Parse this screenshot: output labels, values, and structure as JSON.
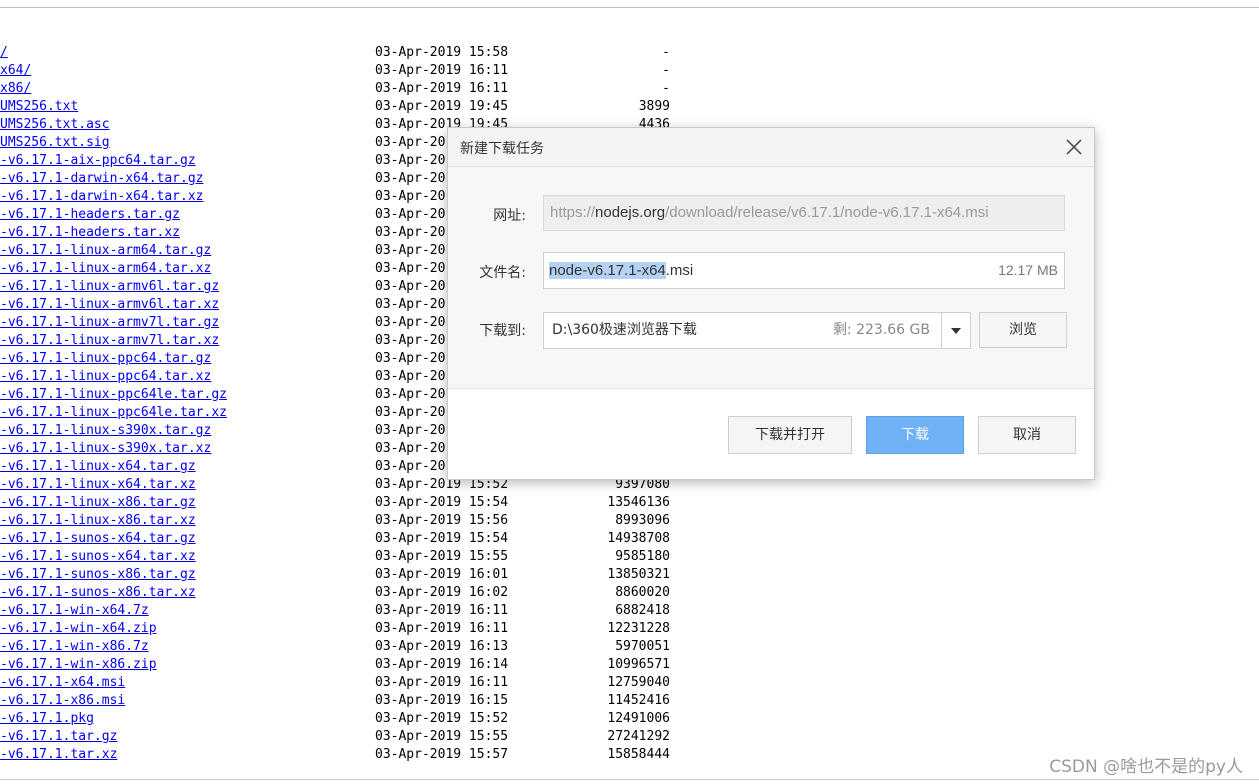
{
  "listing": {
    "rows": [
      {
        "name": "/",
        "date": "03-Apr-2019 15:58",
        "size": "-"
      },
      {
        "name": "x64/",
        "date": "03-Apr-2019 16:11",
        "size": "-"
      },
      {
        "name": "x86/",
        "date": "03-Apr-2019 16:11",
        "size": "-"
      },
      {
        "name": "UMS256.txt",
        "date": "03-Apr-2019 19:45",
        "size": "3899"
      },
      {
        "name": "UMS256.txt.asc",
        "date": "03-Apr-2019 19:45",
        "size": "4436"
      },
      {
        "name": "UMS256.txt.sig",
        "date": "03-Apr-20",
        "size": ""
      },
      {
        "name": "-v6.17.1-aix-ppc64.tar.gz",
        "date": "03-Apr-20",
        "size": ""
      },
      {
        "name": "-v6.17.1-darwin-x64.tar.gz",
        "date": "03-Apr-20",
        "size": ""
      },
      {
        "name": "-v6.17.1-darwin-x64.tar.xz",
        "date": "03-Apr-20",
        "size": ""
      },
      {
        "name": "-v6.17.1-headers.tar.gz",
        "date": "03-Apr-20",
        "size": ""
      },
      {
        "name": "-v6.17.1-headers.tar.xz",
        "date": "03-Apr-20",
        "size": ""
      },
      {
        "name": "-v6.17.1-linux-arm64.tar.gz",
        "date": "03-Apr-20",
        "size": ""
      },
      {
        "name": "-v6.17.1-linux-arm64.tar.xz",
        "date": "03-Apr-20",
        "size": ""
      },
      {
        "name": "-v6.17.1-linux-armv6l.tar.gz",
        "date": "03-Apr-20",
        "size": ""
      },
      {
        "name": "-v6.17.1-linux-armv6l.tar.xz",
        "date": "03-Apr-20",
        "size": ""
      },
      {
        "name": "-v6.17.1-linux-armv7l.tar.gz",
        "date": "03-Apr-20",
        "size": ""
      },
      {
        "name": "-v6.17.1-linux-armv7l.tar.xz",
        "date": "03-Apr-20",
        "size": ""
      },
      {
        "name": "-v6.17.1-linux-ppc64.tar.gz",
        "date": "03-Apr-20",
        "size": ""
      },
      {
        "name": "-v6.17.1-linux-ppc64.tar.xz",
        "date": "03-Apr-20",
        "size": ""
      },
      {
        "name": "-v6.17.1-linux-ppc64le.tar.gz",
        "date": "03-Apr-20",
        "size": ""
      },
      {
        "name": "-v6.17.1-linux-ppc64le.tar.xz",
        "date": "03-Apr-20",
        "size": ""
      },
      {
        "name": "-v6.17.1-linux-s390x.tar.gz",
        "date": "03-Apr-20",
        "size": ""
      },
      {
        "name": "-v6.17.1-linux-s390x.tar.xz",
        "date": "03-Apr-20",
        "size": ""
      },
      {
        "name": "-v6.17.1-linux-x64.tar.gz",
        "date": "03-Apr-20",
        "size": ""
      },
      {
        "name": "-v6.17.1-linux-x64.tar.xz",
        "date": "03-Apr-2019 15:52",
        "size": "9397080"
      },
      {
        "name": "-v6.17.1-linux-x86.tar.gz",
        "date": "03-Apr-2019 15:54",
        "size": "13546136"
      },
      {
        "name": "-v6.17.1-linux-x86.tar.xz",
        "date": "03-Apr-2019 15:56",
        "size": "8993096"
      },
      {
        "name": "-v6.17.1-sunos-x64.tar.gz",
        "date": "03-Apr-2019 15:54",
        "size": "14938708"
      },
      {
        "name": "-v6.17.1-sunos-x64.tar.xz",
        "date": "03-Apr-2019 15:55",
        "size": "9585180"
      },
      {
        "name": "-v6.17.1-sunos-x86.tar.gz",
        "date": "03-Apr-2019 16:01",
        "size": "13850321"
      },
      {
        "name": "-v6.17.1-sunos-x86.tar.xz",
        "date": "03-Apr-2019 16:02",
        "size": "8860020"
      },
      {
        "name": "-v6.17.1-win-x64.7z",
        "date": "03-Apr-2019 16:11",
        "size": "6882418"
      },
      {
        "name": "-v6.17.1-win-x64.zip",
        "date": "03-Apr-2019 16:11",
        "size": "12231228"
      },
      {
        "name": "-v6.17.1-win-x86.7z",
        "date": "03-Apr-2019 16:13",
        "size": "5970051"
      },
      {
        "name": "-v6.17.1-win-x86.zip",
        "date": "03-Apr-2019 16:14",
        "size": "10996571"
      },
      {
        "name": "-v6.17.1-x64.msi",
        "date": "03-Apr-2019 16:11",
        "size": "12759040"
      },
      {
        "name": "-v6.17.1-x86.msi",
        "date": "03-Apr-2019 16:15",
        "size": "11452416"
      },
      {
        "name": "-v6.17.1.pkg",
        "date": "03-Apr-2019 15:52",
        "size": "12491006"
      },
      {
        "name": "-v6.17.1.tar.gz",
        "date": "03-Apr-2019 15:55",
        "size": "27241292"
      },
      {
        "name": "-v6.17.1.tar.xz",
        "date": "03-Apr-2019 15:57",
        "size": "15858444"
      }
    ]
  },
  "watermark": "CSDN @啥也不是的py人",
  "dialog": {
    "title": "新建下载任务",
    "url_label": "网址:",
    "url_prefix": "https://",
    "url_host": "nodejs.org",
    "url_path": "/download/release/v6.17.1/node-v6.17.1-x64.msi",
    "filename_label": "文件名:",
    "filename_selected": "node-v6.17.1-x64",
    "filename_ext": ".msi",
    "file_size": "12.17 MB",
    "saveto_label": "下载到:",
    "save_path": "D:\\360极速浏览器下载",
    "free_space": "剩: 223.66 GB",
    "browse_label": "浏览",
    "download_open_label": "下载并打开",
    "download_label": "下载",
    "cancel_label": "取消"
  },
  "colors": {
    "link": "#0000ee",
    "primary_button": "#6eb2f5",
    "selection": "#b3d2f4"
  },
  "icons": [
    "close-icon",
    "chevron-down-icon"
  ]
}
